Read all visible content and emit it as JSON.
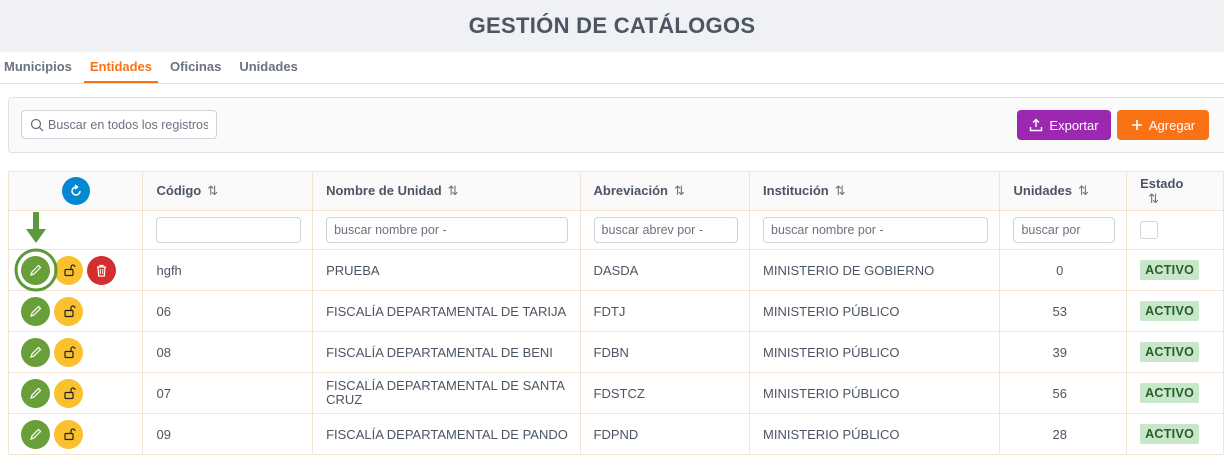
{
  "header": {
    "title": "GESTIÓN DE CATÁLOGOS"
  },
  "tabs": [
    {
      "label": "Municipios",
      "active": false
    },
    {
      "label": "Entidades",
      "active": true
    },
    {
      "label": "Oficinas",
      "active": false
    },
    {
      "label": "Unidades",
      "active": false
    }
  ],
  "toolbar": {
    "search_placeholder": "Buscar en todos los registros",
    "export_label": "Exportar",
    "add_label": "Agregar"
  },
  "table": {
    "columns": [
      "Código",
      "Nombre de Unidad",
      "Abreviación",
      "Institución",
      "Unidades",
      "Estado"
    ],
    "sort_icon": "⇅",
    "filters": {
      "codigo_placeholder": "",
      "nombre_placeholder": "buscar nombre por -",
      "abrev_placeholder": "buscar abrev por -",
      "institucion_placeholder": "buscar nombre por -",
      "unidades_placeholder": "buscar por"
    },
    "rows": [
      {
        "codigo": "hgfh",
        "nombre": "PRUEBA",
        "abrev": "DASDA",
        "institucion": "MINISTERIO DE GOBIERNO",
        "unidades": "0",
        "estado": "ACTIVO"
      },
      {
        "codigo": "06",
        "nombre": "FISCALÍA DEPARTAMENTAL DE TARIJA",
        "abrev": "FDTJ",
        "institucion": "MINISTERIO PÚBLICO",
        "unidades": "53",
        "estado": "ACTIVO"
      },
      {
        "codigo": "08",
        "nombre": "FISCALÍA DEPARTAMENTAL DE BENI",
        "abrev": "FDBN",
        "institucion": "MINISTERIO PÚBLICO",
        "unidades": "39",
        "estado": "ACTIVO"
      },
      {
        "codigo": "07",
        "nombre": "FISCALÍA DEPARTAMENTAL DE SANTA CRUZ",
        "abrev": "FDSTCZ",
        "institucion": "MINISTERIO PÚBLICO",
        "unidades": "56",
        "estado": "ACTIVO"
      },
      {
        "codigo": "09",
        "nombre": "FISCALÍA DEPARTAMENTAL DE PANDO",
        "abrev": "FDPND",
        "institucion": "MINISTERIO PÚBLICO",
        "unidades": "28",
        "estado": "ACTIVO"
      }
    ]
  },
  "icons": {
    "refresh": "refresh-icon",
    "edit": "pencil-icon",
    "lock": "unlock-icon",
    "delete": "trash-icon",
    "export": "upload-icon",
    "add": "plus-icon",
    "search": "search-icon",
    "annotation": "arrow-down-icon"
  },
  "colors": {
    "accent": "#f97316",
    "export": "#9c27b0",
    "edit": "#689f38",
    "lock": "#fbc02d",
    "delete": "#d32f2f",
    "refresh": "#0288d1",
    "active_badge_bg": "#c8e6c9",
    "active_badge_text": "#256029"
  }
}
